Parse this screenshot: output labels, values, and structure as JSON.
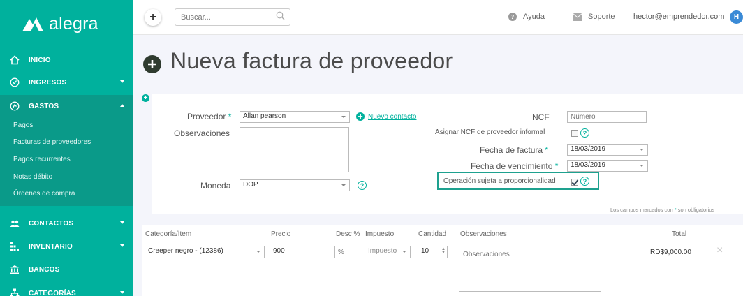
{
  "app": {
    "logo_text": "alegra"
  },
  "sidebar": {
    "items": [
      {
        "label": "INICIO"
      },
      {
        "label": "INGRESOS"
      },
      {
        "label": "GASTOS"
      },
      {
        "label": "CONTACTOS"
      },
      {
        "label": "INVENTARIO"
      },
      {
        "label": "BANCOS"
      },
      {
        "label": "CATEGORÍAS"
      }
    ],
    "gastos_sub": [
      {
        "label": "Pagos"
      },
      {
        "label": "Facturas de proveedores"
      },
      {
        "label": "Pagos recurrentes"
      },
      {
        "label": "Notas débito"
      },
      {
        "label": "Órdenes de compra"
      }
    ]
  },
  "topbar": {
    "new_label": "+",
    "search_placeholder": "Buscar...",
    "help_label": "Ayuda",
    "support_label": "Soporte",
    "user_email": "hector@emprendedor.com",
    "avatar_initial": "H"
  },
  "page": {
    "title": "Nueva factura de proveedor"
  },
  "form": {
    "proveedor_label": "Proveedor",
    "required_mark": "*",
    "proveedor_value": "Allan pearson",
    "new_contact_label": "Nuevo contacto",
    "observaciones_label": "Observaciones",
    "moneda_label": "Moneda",
    "moneda_value": "DOP",
    "ncf_label": "NCF",
    "ncf_placeholder": "Número",
    "informal_label": "Asignar NCF de proveedor informal",
    "fecha_factura_label": "Fecha de factura",
    "fecha_factura_value": "18/03/2019",
    "fecha_venc_label": "Fecha de vencimiento",
    "fecha_venc_value": "18/03/2019",
    "proporcionalidad_label": "Operación sujeta a proporcionalidad",
    "required_note_pre": "Los campos marcados con",
    "required_note_post": "son obligatorios",
    "help_mark": "?"
  },
  "items_table": {
    "headers": {
      "categoria": "Categoría/Ítem",
      "precio": "Precio",
      "desc": "Desc %",
      "impuesto": "Impuesto",
      "cantidad": "Cantidad",
      "observaciones": "Observaciones",
      "total": "Total"
    },
    "row": {
      "categoria": "Creeper negro - (12386)",
      "precio": "900",
      "desc_placeholder": "%",
      "impuesto": "Impuesto",
      "cantidad": "10",
      "observaciones_placeholder": "Observaciones",
      "total": "RD$9,000.00",
      "remove": "×"
    }
  },
  "colors": {
    "brand": "#00b19d",
    "sidebar_active": "#0a9a89",
    "avatar": "#3a8ad6"
  }
}
